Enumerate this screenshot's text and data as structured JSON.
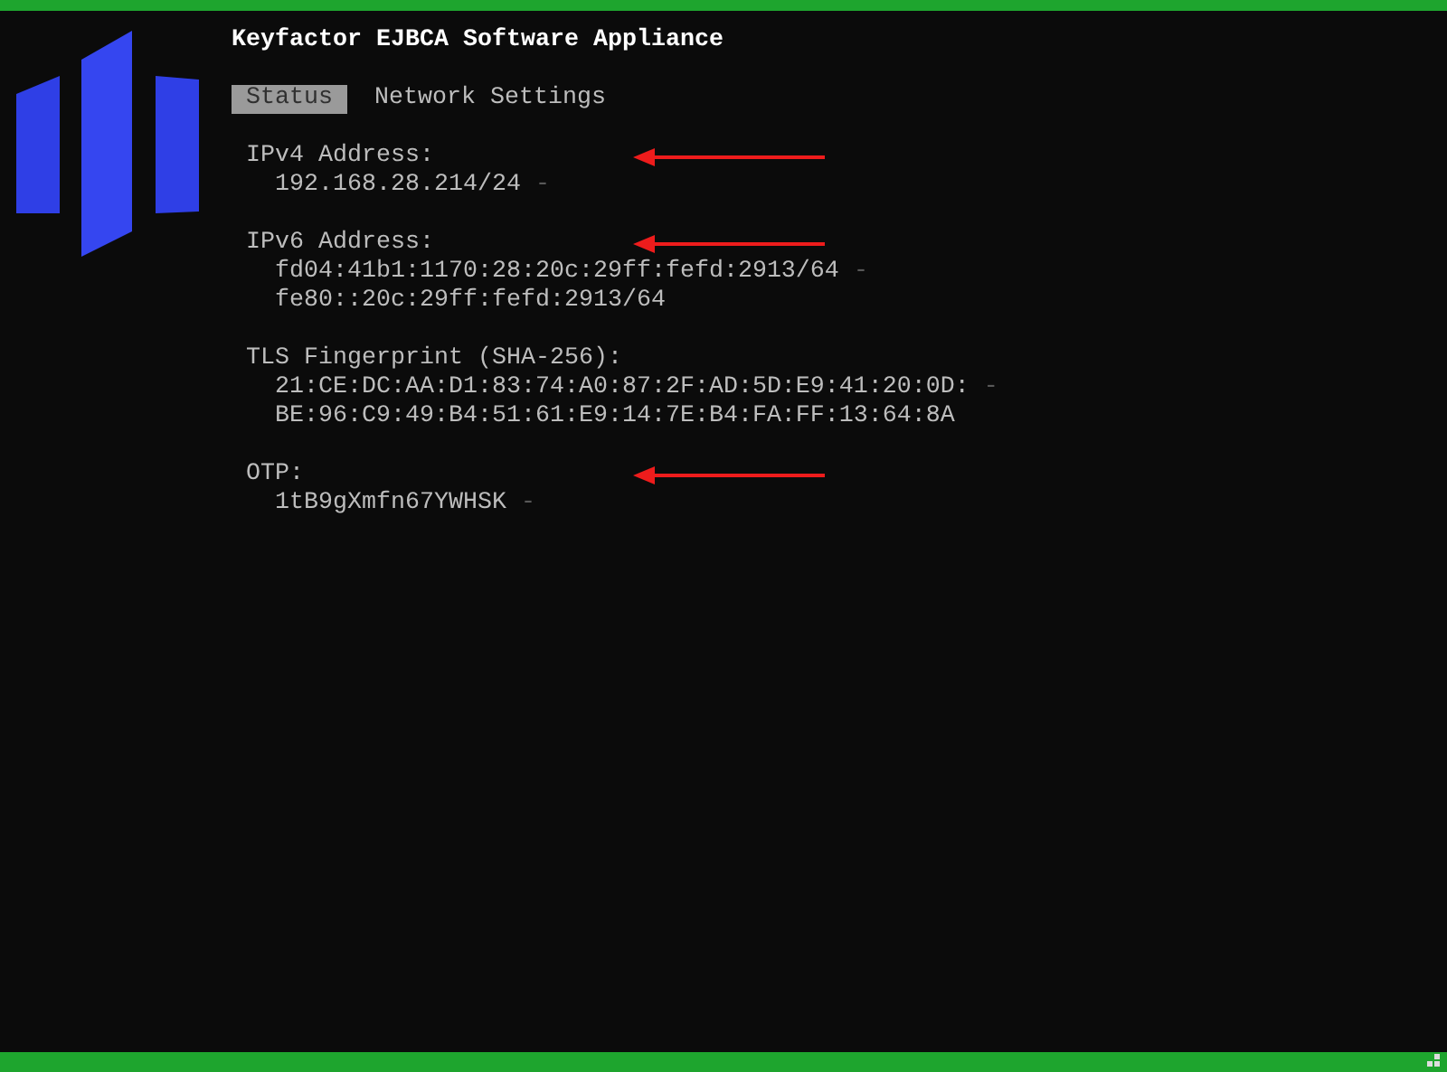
{
  "header": {
    "title": "Keyfactor EJBCA Software Appliance"
  },
  "tabs": [
    {
      "label": "Status",
      "selected": true
    },
    {
      "label": "Network Settings",
      "selected": false
    }
  ],
  "sections": [
    {
      "label": "IPv4 Address:",
      "arrow": true,
      "lines": [
        {
          "text": "192.168.28.214/24",
          "suffix": "-"
        }
      ]
    },
    {
      "label": "IPv6 Address:",
      "arrow": true,
      "lines": [
        {
          "text": "fd04:41b1:1170:28:20c:29ff:fefd:2913/64",
          "suffix": "-"
        },
        {
          "text": "fe80::20c:29ff:fefd:2913/64"
        }
      ]
    },
    {
      "label": "TLS Fingerprint (SHA-256):",
      "arrow": false,
      "lines": [
        {
          "text": "21:CE:DC:AA:D1:83:74:A0:87:2F:AD:5D:E9:41:20:0D:",
          "suffix": "-"
        },
        {
          "text": "BE:96:C9:49:B4:51:61:E9:14:7E:B4:FA:FF:13:64:8A"
        }
      ]
    },
    {
      "label": "OTP:",
      "arrow": true,
      "lines": [
        {
          "text": "1tB9gXmfn67YWHSK",
          "suffix": "-"
        }
      ]
    }
  ]
}
